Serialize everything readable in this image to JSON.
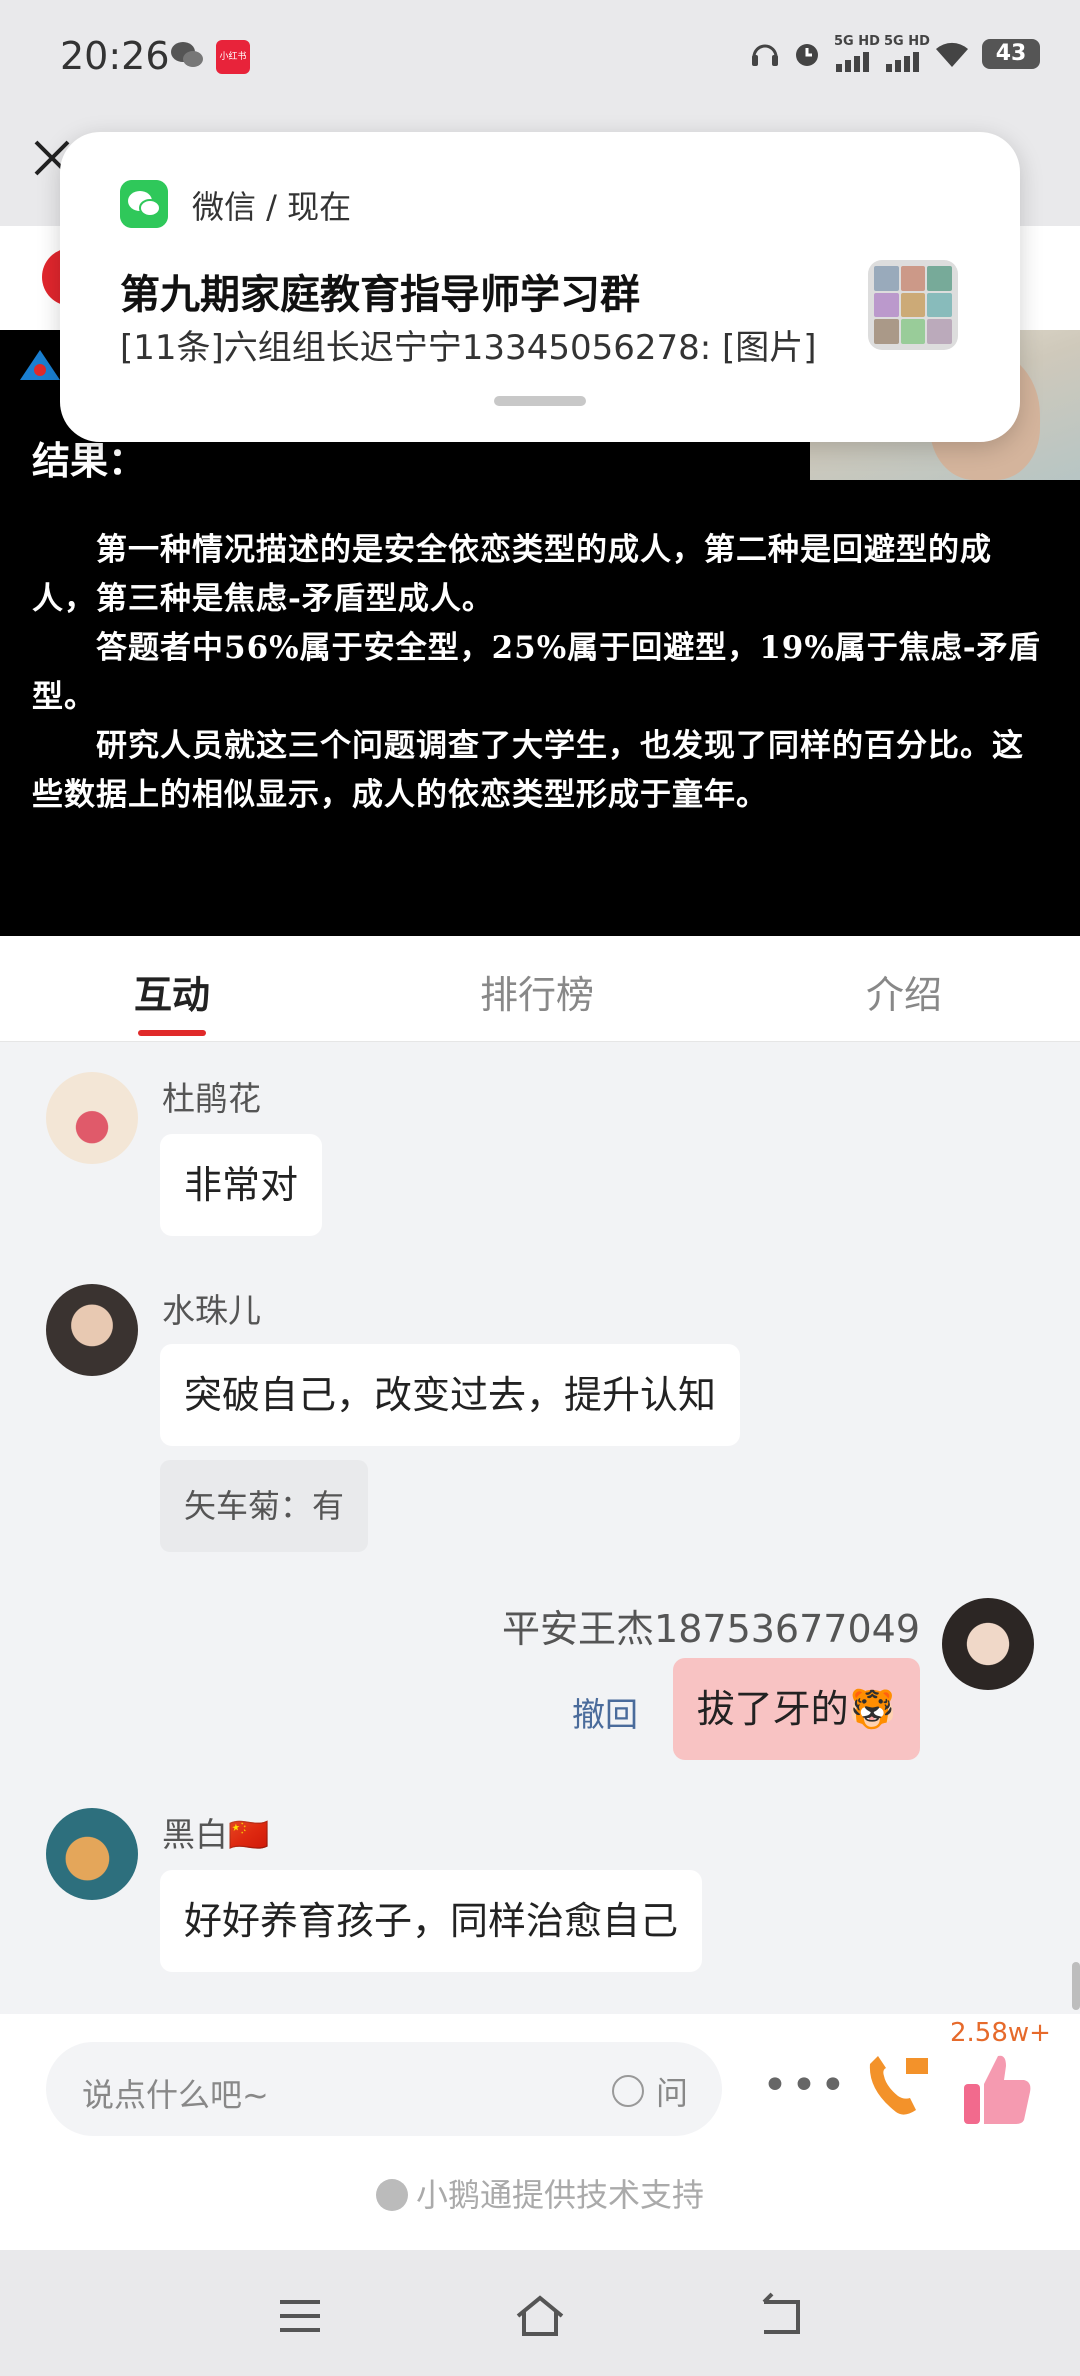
{
  "status": {
    "time": "20:26",
    "redbook_label": "小红书",
    "signal1": "5G HD",
    "signal2": "5G HD",
    "battery": "43"
  },
  "notification": {
    "app": "微信 / 现在",
    "title": "第九期家庭教育指导师学习群",
    "body": "[11条]六组组长迟宁宁13345056278: [图片]"
  },
  "video": {
    "result_title": "结果：",
    "paragraphs": [
      "　　第一种情况描述的是安全依恋类型的成人，第二种是回避型的成人，第三种是焦虑-矛盾型成人。",
      "　　答题者中56%属于安全型，25%属于回避型，19%属于焦虑-矛盾型。",
      "　　研究人员就这三个问题调查了大学生，也发现了同样的百分比。这些数据上的相似显示，成人的依恋类型形成于童年。"
    ]
  },
  "tabs": [
    {
      "label": "互动",
      "active": true
    },
    {
      "label": "排行榜",
      "active": false
    },
    {
      "label": "介绍",
      "active": false
    }
  ],
  "messages": [
    {
      "user": "杜鹃花",
      "text": "非常对"
    },
    {
      "user": "水珠儿",
      "text": "突破自己，改变过去，提升认知",
      "quote": "矢车菊：有"
    },
    {
      "user": "平安王杰18753677049",
      "text": "拔了牙的🐯",
      "recall": "撤回",
      "mine": true
    },
    {
      "user": "黑白🇨🇳",
      "text": "好好养育孩子，同样治愈自己"
    }
  ],
  "input": {
    "placeholder": "说点什么吧~",
    "ask": "问",
    "more": "•••",
    "like_count": "2.58w+",
    "support": "小鹅通提供技术支持"
  },
  "colors": {
    "accent_red": "#e02a2a",
    "my_bubble": "#f8c3c3",
    "wechat_green": "#2fc85a"
  }
}
